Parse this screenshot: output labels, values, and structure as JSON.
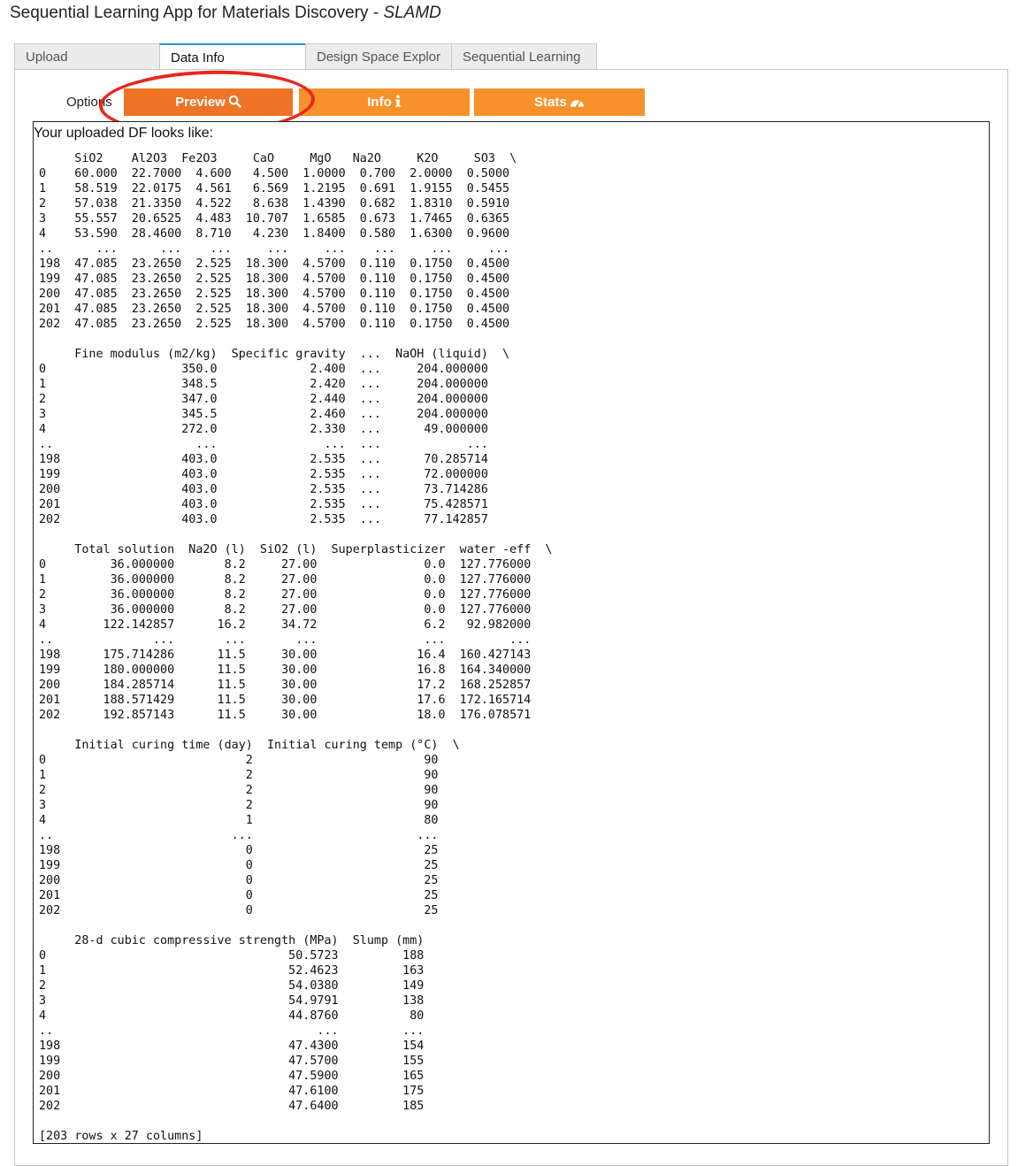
{
  "app": {
    "title": "Sequential Learning App for Materials Discovery - ",
    "title_italic": "SLAMD"
  },
  "tabs": [
    {
      "label": "Upload",
      "active": false
    },
    {
      "label": "Data Info",
      "active": true
    },
    {
      "label": "Design Space Explor",
      "active": false
    },
    {
      "label": "Sequential Learning",
      "active": false
    }
  ],
  "options": {
    "label": "Options",
    "buttons": [
      {
        "label": "Preview",
        "icon": "search-icon",
        "active": true
      },
      {
        "label": "Info",
        "icon": "info-icon",
        "active": false
      },
      {
        "label": "Stats",
        "icon": "gauge-icon",
        "active": false
      }
    ]
  },
  "colors": {
    "button": "#f7922b",
    "button_active": "#ee7324",
    "annotation_circle": "#e8281d",
    "active_tab_accent": "#2d8fd0"
  },
  "output": {
    "caption": "Your uploaded DF looks like:",
    "dataframe_text": "     SiO2    Al2O3  Fe2O3     CaO     MgO   Na2O     K2O     SO3  \\\n0    60.000  22.7000  4.600   4.500  1.0000  0.700  2.0000  0.5000\n1    58.519  22.0175  4.561   6.569  1.2195  0.691  1.9155  0.5455\n2    57.038  21.3350  4.522   8.638  1.4390  0.682  1.8310  0.5910\n3    55.557  20.6525  4.483  10.707  1.6585  0.673  1.7465  0.6365\n4    53.590  28.4600  8.710   4.230  1.8400  0.580  1.6300  0.9600\n..      ...      ...    ...     ...     ...    ...     ...     ...\n198  47.085  23.2650  2.525  18.300  4.5700  0.110  0.1750  0.4500\n199  47.085  23.2650  2.525  18.300  4.5700  0.110  0.1750  0.4500\n200  47.085  23.2650  2.525  18.300  4.5700  0.110  0.1750  0.4500\n201  47.085  23.2650  2.525  18.300  4.5700  0.110  0.1750  0.4500\n202  47.085  23.2650  2.525  18.300  4.5700  0.110  0.1750  0.4500\n\n     Fine modulus (m2/kg)  Specific gravity  ...  NaOH (liquid)  \\\n0                   350.0             2.400  ...     204.000000\n1                   348.5             2.420  ...     204.000000\n2                   347.0             2.440  ...     204.000000\n3                   345.5             2.460  ...     204.000000\n4                   272.0             2.330  ...      49.000000\n..                    ...               ...  ...            ...\n198                 403.0             2.535  ...      70.285714\n199                 403.0             2.535  ...      72.000000\n200                 403.0             2.535  ...      73.714286\n201                 403.0             2.535  ...      75.428571\n202                 403.0             2.535  ...      77.142857\n\n     Total solution  Na2O (l)  SiO2 (l)  Superplasticizer  water -eff  \\\n0         36.000000       8.2     27.00               0.0  127.776000\n1         36.000000       8.2     27.00               0.0  127.776000\n2         36.000000       8.2     27.00               0.0  127.776000\n3         36.000000       8.2     27.00               0.0  127.776000\n4        122.142857      16.2     34.72               6.2   92.982000\n..              ...       ...       ...               ...         ...\n198      175.714286      11.5     30.00              16.4  160.427143\n199      180.000000      11.5     30.00              16.8  164.340000\n200      184.285714      11.5     30.00              17.2  168.252857\n201      188.571429      11.5     30.00              17.6  172.165714\n202      192.857143      11.5     30.00              18.0  176.078571\n\n     Initial curing time (day)  Initial curing temp (°C)  \\\n0                            2                        90\n1                            2                        90\n2                            2                        90\n3                            2                        90\n4                            1                        80\n..                         ...                       ...\n198                          0                        25\n199                          0                        25\n200                          0                        25\n201                          0                        25\n202                          0                        25\n\n     28-d cubic compressive strength (MPa)  Slump (mm)\n0                                  50.5723         188\n1                                  52.4623         163\n2                                  54.0380         149\n3                                  54.9791         138\n4                                  44.8760          80\n..                                     ...         ...\n198                                47.4300         154\n199                                47.5700         155\n200                                47.5900         165\n201                                47.6100         175\n202                                47.6400         185\n\n[203 rows x 27 columns]"
  }
}
